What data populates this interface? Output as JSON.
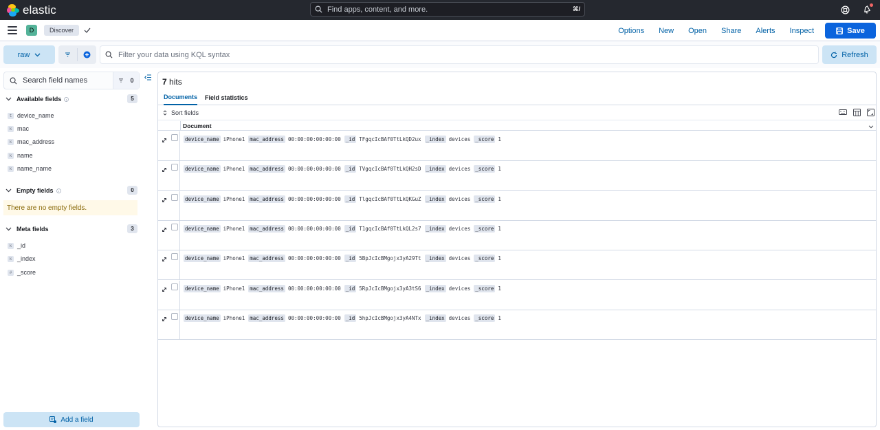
{
  "header": {
    "brand": "elastic",
    "search_placeholder": "Find apps, content, and more.",
    "search_shortcut": "⌘/"
  },
  "appbar": {
    "space_initial": "D",
    "breadcrumb": "Discover",
    "menu": [
      "Options",
      "New",
      "Open",
      "Share",
      "Alerts",
      "Inspect"
    ],
    "save_label": "Save"
  },
  "querybar": {
    "data_view": "raw",
    "placeholder": "Filter your data using KQL syntax",
    "refresh_label": "Refresh"
  },
  "sidebar": {
    "search_placeholder": "Search field names",
    "filter_count": "0",
    "available": {
      "title": "Available fields",
      "count": "5",
      "fields": [
        {
          "type": "t",
          "name": "device_name"
        },
        {
          "type": "k",
          "name": "mac"
        },
        {
          "type": "k",
          "name": "mac_address"
        },
        {
          "type": "k",
          "name": "name"
        },
        {
          "type": "k",
          "name": "name_name"
        }
      ]
    },
    "empty": {
      "title": "Empty fields",
      "count": "0",
      "message": "There are no empty fields."
    },
    "meta": {
      "title": "Meta fields",
      "count": "3",
      "fields": [
        {
          "type": "k",
          "name": "_id"
        },
        {
          "type": "k",
          "name": "_index"
        },
        {
          "type": "#",
          "name": "_score"
        }
      ]
    },
    "add_field_label": "Add a field"
  },
  "main": {
    "hits_count": "7",
    "hits_label": "hits",
    "tabs": [
      "Documents",
      "Field statistics"
    ],
    "sort_label": "Sort fields",
    "column_header": "Document",
    "rows": [
      {
        "device_name": "iPhone1",
        "mac_address": "00:00:00:00:00:00",
        "_id": "TFgqcIcBAf0TtLkQD2ux",
        "_index": "devices",
        "_score": "1"
      },
      {
        "device_name": "iPhone1",
        "mac_address": "00:00:00:00:00:00",
        "_id": "TVgqcIcBAf0TtLkQH2sD",
        "_index": "devices",
        "_score": "1"
      },
      {
        "device_name": "iPhone1",
        "mac_address": "00:00:00:00:00:00",
        "_id": "TlgqcIcBAf0TtLkQKGuZ",
        "_index": "devices",
        "_score": "1"
      },
      {
        "device_name": "iPhone1",
        "mac_address": "00:00:00:00:00:00",
        "_id": "T1gqcIcBAf0TtLkQL2s7",
        "_index": "devices",
        "_score": "1"
      },
      {
        "device_name": "iPhone1",
        "mac_address": "00:00:00:00:00:00",
        "_id": "5BpJcIcBMgojx3yA29Tt",
        "_index": "devices",
        "_score": "1"
      },
      {
        "device_name": "iPhone1",
        "mac_address": "00:00:00:00:00:00",
        "_id": "5RpJcIcBMgojx3yA3tS6",
        "_index": "devices",
        "_score": "1"
      },
      {
        "device_name": "iPhone1",
        "mac_address": "00:00:00:00:00:00",
        "_id": "5hpJcIcBMgojx3yA4NTx",
        "_index": "devices",
        "_score": "1"
      }
    ],
    "field_keys": [
      "device_name",
      "mac_address",
      "_id",
      "_index",
      "_score"
    ]
  },
  "colors": {
    "header_bg": "#25282f",
    "accent": "#0b64dd",
    "link": "#0061a6",
    "light_button": "#cce4f5"
  }
}
